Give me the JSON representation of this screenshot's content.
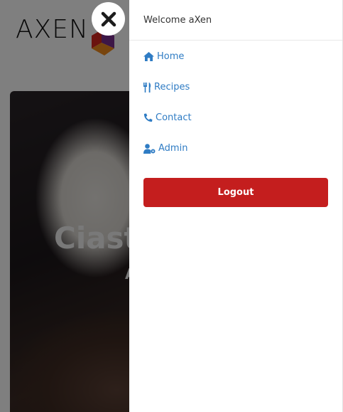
{
  "brand": {
    "name": "AXEN",
    "mark_icon": "axen-cube-logo"
  },
  "hero": {
    "title": "Ciast",
    "subtitle": "A"
  },
  "close_button": {
    "icon": "close-icon"
  },
  "drawer": {
    "welcome": "Welcome aXen",
    "nav": [
      {
        "label": "Home",
        "icon": "home-icon"
      },
      {
        "label": "Recipes",
        "icon": "utensils-icon"
      },
      {
        "label": "Contact",
        "icon": "phone-icon"
      },
      {
        "label": "Admin",
        "icon": "user-cog-icon"
      }
    ],
    "logout_label": "Logout"
  },
  "colors": {
    "link": "#2f7cc4",
    "logout_bg": "#c41e1e",
    "logo_red": "#d7261e",
    "logo_orange": "#f08a1c",
    "logo_purple": "#7a2e8f"
  }
}
